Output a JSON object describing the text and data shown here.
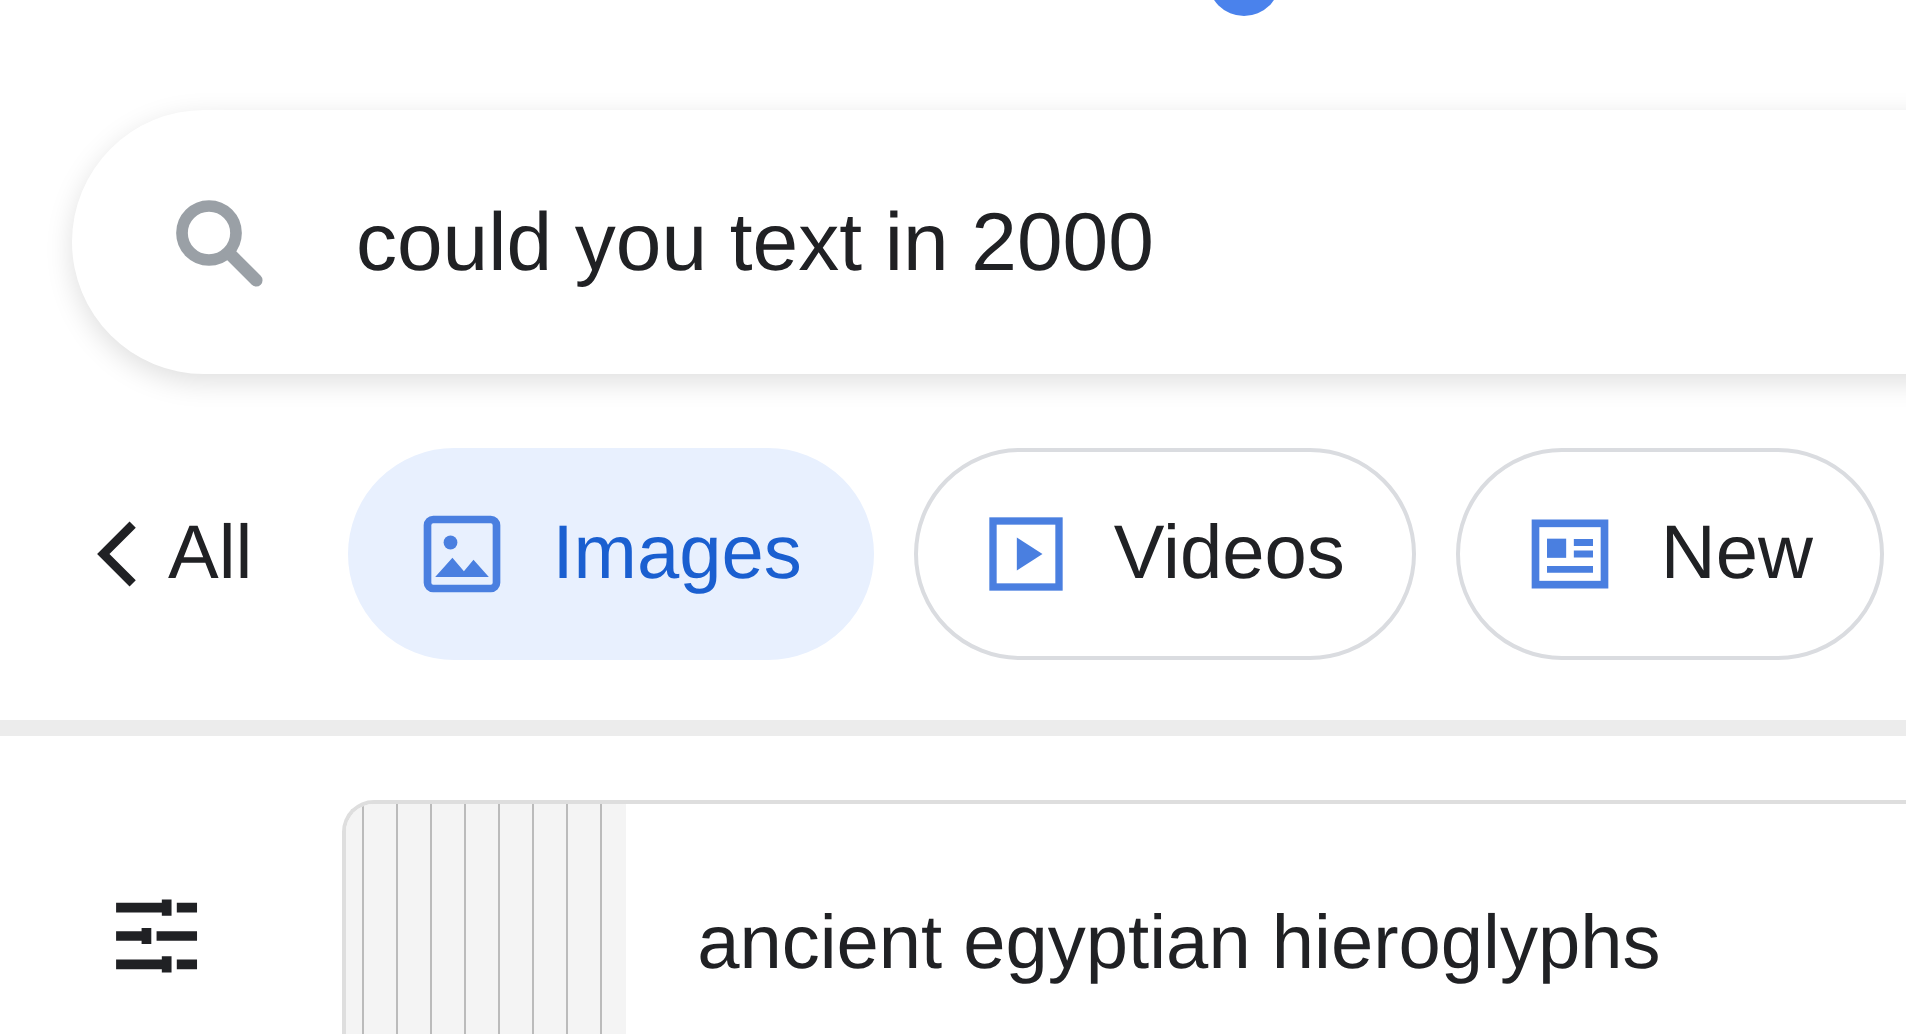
{
  "search": {
    "value": "could you text in 2000"
  },
  "back": {
    "label": "All"
  },
  "tabs": [
    {
      "label": "Images",
      "kind": "images",
      "selected": true
    },
    {
      "label": "Videos",
      "kind": "videos",
      "selected": false
    },
    {
      "label": "New",
      "kind": "news",
      "selected": false
    }
  ],
  "suggestions": [
    {
      "label": "ancient egyptian hieroglyphs"
    }
  ]
}
